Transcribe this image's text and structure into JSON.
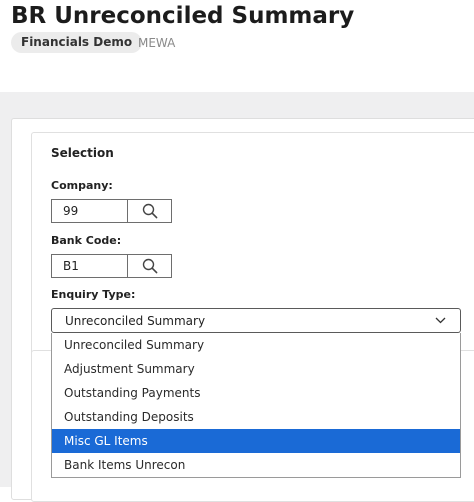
{
  "header": {
    "title": "BR Unreconciled Summary",
    "company_badge": "Financials Demo",
    "environment": "MEWA"
  },
  "selection": {
    "title": "Selection",
    "company": {
      "label": "Company:",
      "value": "99",
      "lookup_icon": "search-icon"
    },
    "bank_code": {
      "label": "Bank Code:",
      "value": "B1",
      "lookup_icon": "search-icon"
    },
    "enquiry_type": {
      "label": "Enquiry Type:",
      "value": "Unreconciled Summary",
      "chevron_icon": "chevron-down-icon",
      "options": [
        "Unreconciled Summary",
        "Adjustment Summary",
        "Outstanding Payments",
        "Outstanding Deposits",
        "Misc GL Items",
        "Bank Items Unrecon"
      ],
      "highlighted_option": "Misc GL Items"
    }
  },
  "colors": {
    "highlight": "#1a6ad6",
    "workspace_bg": "#efeff0",
    "badge_bg": "#ececec"
  }
}
